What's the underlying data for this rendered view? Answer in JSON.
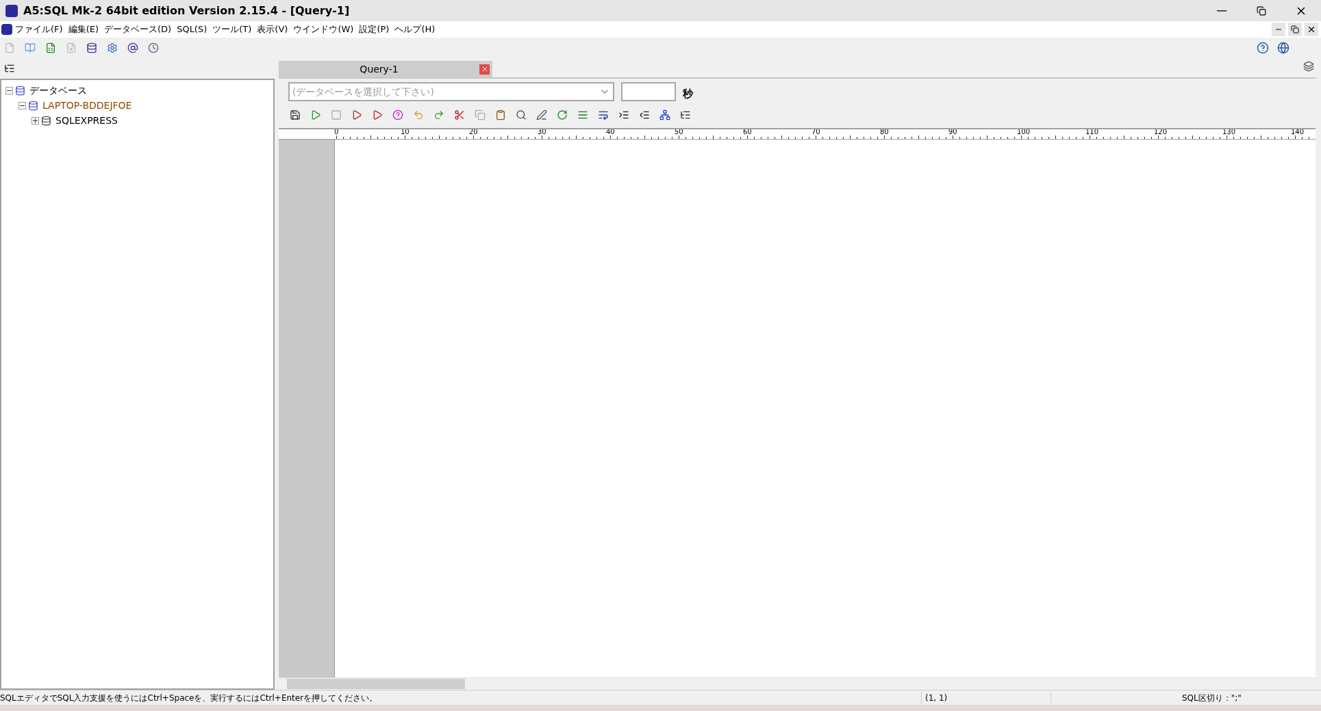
{
  "window": {
    "title": "A5:SQL Mk-2 64bit edition Version 2.15.4 - [Query-1]"
  },
  "menu": [
    "ファイル(F)",
    "編集(E)",
    "データベース(D)",
    "SQL(S)",
    "ツール(T)",
    "表示(V)",
    "ウインドウ(W)",
    "設定(P)",
    "ヘルプ(H)"
  ],
  "tree": [
    {
      "label": "データベース",
      "expanded": true,
      "children": [
        {
          "label": "LAPTOP-BDDEJFOE",
          "expanded": true,
          "children": [
            {
              "label": "SQLEXPRESS",
              "expanded": false
            }
          ]
        }
      ]
    }
  ],
  "tabs": [
    {
      "label": "Query-1",
      "selected": true
    }
  ],
  "database_select": {
    "placeholder": "(データベースを選択して下さい)"
  },
  "timeout": {
    "unit": "秒"
  },
  "ruler": {
    "labels": [
      "0",
      "10",
      "20",
      "30",
      "40",
      "50",
      "60",
      "70",
      "80",
      "90",
      "100",
      "110",
      "120",
      "130",
      "140"
    ]
  },
  "status_bar": {
    "message": "SQLエディタでSQL入力支援を使うにはCtrl+Spaceを、実行するにはCtrl+Enterを押してください。",
    "position": "(1, 1)",
    "delimiter": "SQL区切り：\";\""
  }
}
